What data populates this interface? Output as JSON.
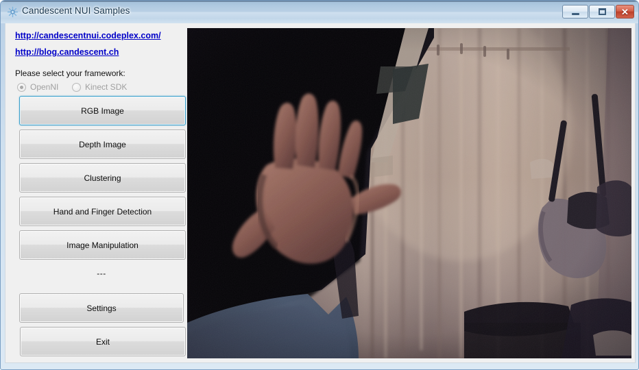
{
  "window": {
    "title": "Candescent NUI Samples",
    "icon": "snowflake-icon",
    "controls": {
      "minimize": "Minimize",
      "maximize": "Maximize",
      "close": "Close",
      "close_glyph": "✕"
    },
    "colors": {
      "titlebar_top": "#5b7591",
      "titlebar_mid": "#b3cce2",
      "client_bg": "#f0f0f0",
      "frame": "#b8cfe6",
      "close_button": "#bb3f2a",
      "focus_outline": "#3c9fc9",
      "link": "#0000c8"
    }
  },
  "sidebar": {
    "links": [
      {
        "label": "http://candescentnui.codeplex.com/",
        "name": "link-codeplex"
      },
      {
        "label": "http://blog.candescent.ch",
        "name": "link-blog"
      }
    ],
    "framework_label": "Please select your framework:",
    "framework_options": [
      {
        "label": "OpenNI",
        "selected": true,
        "enabled": false
      },
      {
        "label": "Kinect SDK",
        "selected": false,
        "enabled": false
      }
    ],
    "buttons": [
      {
        "label": "RGB Image",
        "focused": true
      },
      {
        "label": "Depth Image",
        "focused": false
      },
      {
        "label": "Clustering",
        "focused": false
      },
      {
        "label": "Hand and Finger Detection",
        "focused": false
      },
      {
        "label": "Image Manipulation",
        "focused": false
      }
    ],
    "separator": "---",
    "bottom_buttons": [
      {
        "label": "Settings"
      },
      {
        "label": "Exit"
      }
    ]
  },
  "preview": {
    "name": "rgb-camera-preview",
    "description": "RGB camera frame: an open hand held up in front of a bright curtain, dark room to the left"
  }
}
